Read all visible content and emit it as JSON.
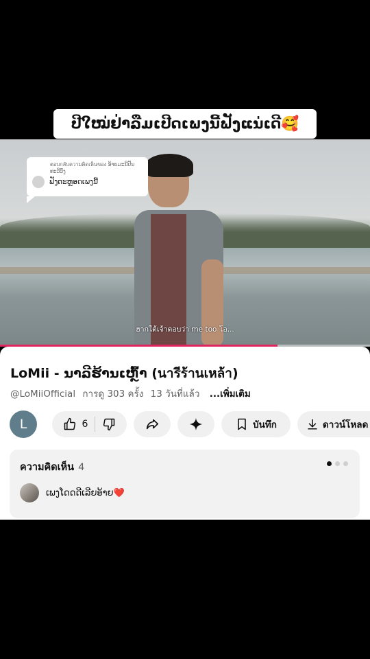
{
  "banner": {
    "text": "ປີໃໝ່ຢ່າລືມເປີດເພງນີ້ຟັງແນ່ເດີ🥰"
  },
  "reply_sticker": {
    "header": "ตอบกลับความคิดเห็นของ ອ້າຍມະນີປັນ ທະວີວົງ",
    "text": "ຟັງຕະຫຼອດເພງນີ້"
  },
  "video": {
    "subtitle": "ฮากใต้เจ้าตอบว่า me too โอ...",
    "progress_fraction": 0.75,
    "accent": "#e0245e"
  },
  "video_info": {
    "title": "LoMii - ນາລີຮ້ານເຫຼົ້າ (นารีร้านเหล้า)",
    "channel": "@LoMiiOfficial",
    "views": "การดู 303 ครั้ง",
    "age": "13 วันที่แล้ว",
    "more": "...เพิ่มเติม"
  },
  "actions": {
    "avatar_letter": "L",
    "like_count": "6",
    "like_icon": "thumb-up-icon",
    "dislike_icon": "thumb-down-icon",
    "share_icon": "share-icon",
    "remix_icon": "sparkle-icon",
    "save_label": "บันทึก",
    "download_label": "ดาวน์โหลด"
  },
  "comments": {
    "label": "ความคิดเห็น",
    "count": "4",
    "top_comment": "ເພງໂດດດີເລີຍອ້າຍ❤️"
  }
}
